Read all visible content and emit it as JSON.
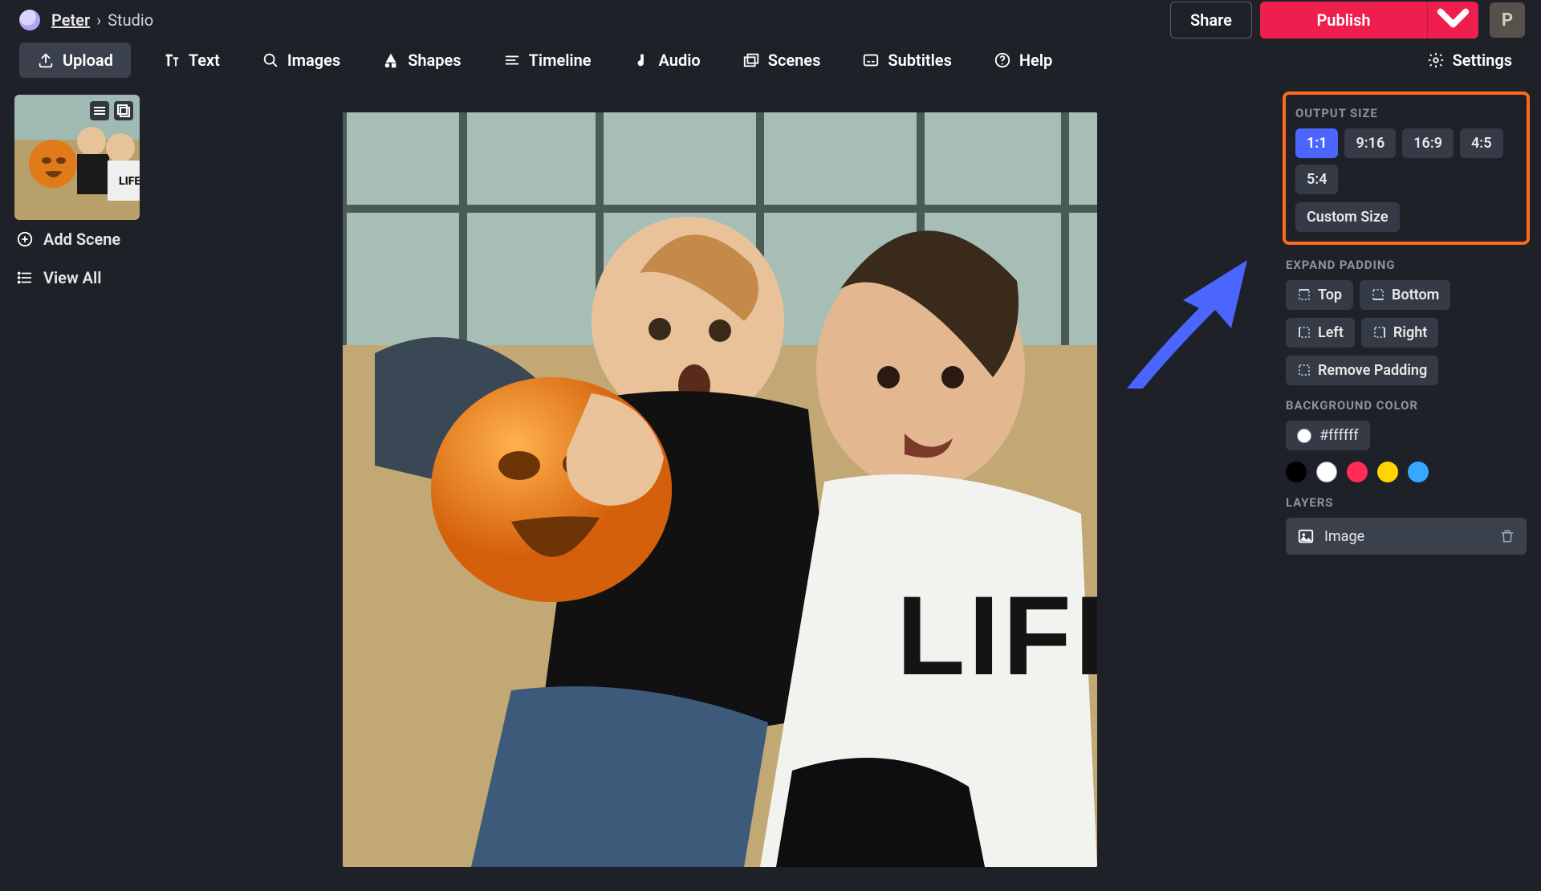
{
  "breadcrumb": {
    "user": "Peter",
    "page": "Studio"
  },
  "header": {
    "share": "Share",
    "publish": "Publish",
    "profile_initial": "P"
  },
  "toolbar": {
    "upload": "Upload",
    "text": "Text",
    "images": "Images",
    "shapes": "Shapes",
    "timeline": "Timeline",
    "audio": "Audio",
    "scenes": "Scenes",
    "subtitles": "Subtitles",
    "help": "Help",
    "settings": "Settings"
  },
  "left": {
    "add_scene": "Add Scene",
    "view_all": "View All"
  },
  "panel": {
    "output_title": "OUTPUT SIZE",
    "ratios": [
      "1:1",
      "9:16",
      "16:9",
      "4:5",
      "5:4"
    ],
    "active_ratio": "1:1",
    "custom_size": "Custom Size",
    "expand_title": "EXPAND PADDING",
    "pad": {
      "top": "Top",
      "bottom": "Bottom",
      "left": "Left",
      "right": "Right",
      "remove": "Remove Padding"
    },
    "bg_title": "BACKGROUND COLOR",
    "bg_hex": "#ffffff",
    "swatches": [
      "#000000",
      "#ffffff",
      "#ff2c55",
      "#ffd400",
      "#35a9ff"
    ],
    "layers_title": "LAYERS",
    "layer_image": "Image"
  }
}
